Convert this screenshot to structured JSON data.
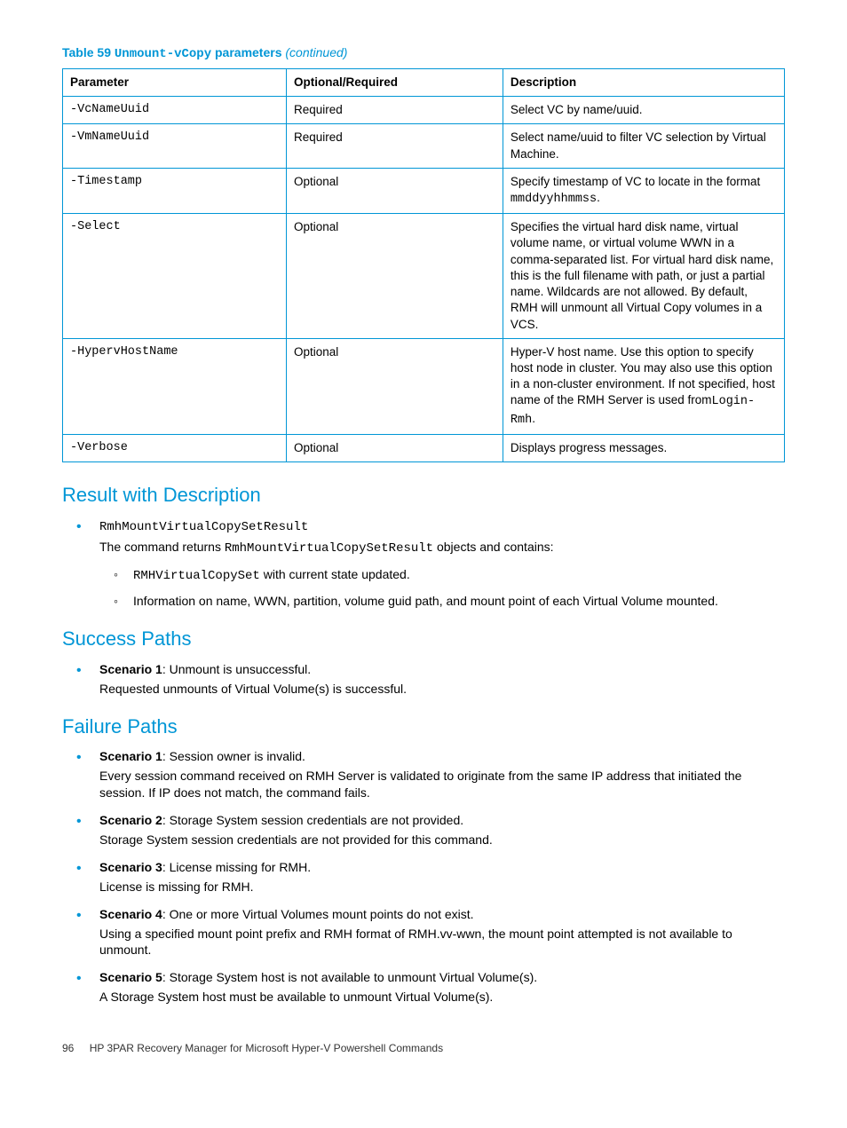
{
  "tableCaption": {
    "prefix": "Table 59",
    "command": "Unmount-vCopy",
    "suffix": " parameters ",
    "continued": "(continued)"
  },
  "headers": {
    "c1": "Parameter",
    "c2": "Optional/Required",
    "c3": "Description"
  },
  "rows": [
    {
      "param": "-VcNameUuid",
      "req": "Required",
      "desc": "Select VC by name/uuid."
    },
    {
      "param": "-VmNameUuid",
      "req": "Required",
      "desc": "Select name/uuid to filter VC selection by Virtual Machine."
    },
    {
      "param": "-Timestamp",
      "req": "Optional",
      "desc": "Specify timestamp of VC to locate in the format ",
      "mono": "mmddyyhhmmss",
      "tail": "."
    },
    {
      "param": "-Select",
      "req": "Optional",
      "desc": "Specifies the virtual hard disk name, virtual volume name, or virtual volume WWN in a comma-separated list. For virtual hard disk name, this is the full filename with path, or just a partial name. Wildcards are not allowed. By default, RMH will unmount all Virtual Copy volumes in a VCS."
    },
    {
      "param": "-HypervHostName",
      "req": "Optional",
      "desc": "Hyper-V host name. Use this option to specify host node in cluster. You may also use this option in a non-cluster environment. If not specified, host name of the RMH Server is used from",
      "mono": "Login-Rmh",
      "tail": "."
    },
    {
      "param": "-Verbose",
      "req": "Optional",
      "desc": "Displays progress messages."
    }
  ],
  "sections": {
    "result": {
      "title": "Result with Description",
      "item1mono": "RmhMountVirtualCopySetResult",
      "item1line2a": "The command returns ",
      "item1line2mono": "RmhMountVirtualCopySetResult",
      "item1line2b": " objects and contains:",
      "sub1mono": "RMHVirtualCopySet",
      "sub1text": " with current state updated.",
      "sub2text": "Information on name, WWN, partition, volume guid path, and mount point of each Virtual Volume mounted."
    },
    "success": {
      "title": "Success Paths",
      "s1label": "Scenario 1",
      "s1a": ": Unmount is unsuccessful.",
      "s1b": "Requested unmounts of Virtual Volume(s) is successful."
    },
    "failure": {
      "title": "Failure Paths",
      "items": [
        {
          "label": "Scenario 1",
          "a": ": Session owner is invalid.",
          "b": "Every session command received on RMH Server is validated to originate from the same IP address that initiated the session. If IP does not match, the command fails."
        },
        {
          "label": "Scenario 2",
          "a": ": Storage System session credentials are not provided.",
          "b": "Storage System session credentials are not provided for this command."
        },
        {
          "label": "Scenario 3",
          "a": ": License missing for RMH.",
          "b": "License is missing for RMH."
        },
        {
          "label": "Scenario 4",
          "a": ": One or more Virtual Volumes mount points do not exist.",
          "b": "Using a specified mount point prefix and RMH format of RMH.vv-wwn, the mount point attempted is not available to unmount."
        },
        {
          "label": "Scenario 5",
          "a": ": Storage System host is not available to unmount Virtual Volume(s).",
          "b": "A Storage System host must be available to unmount Virtual Volume(s)."
        }
      ]
    }
  },
  "footer": {
    "page": "96",
    "title": "HP 3PAR Recovery Manager for Microsoft Hyper-V Powershell Commands"
  }
}
